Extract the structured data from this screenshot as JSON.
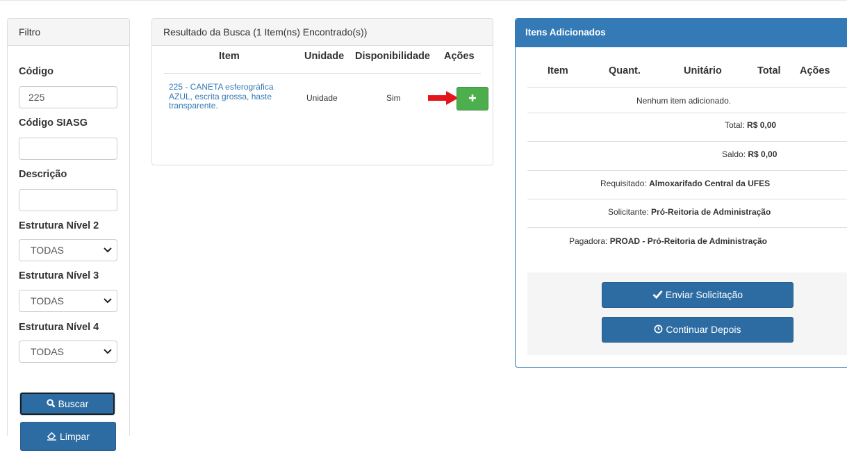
{
  "filter": {
    "title": "Filtro",
    "codigo_label": "Código",
    "codigo_value": "225",
    "siasg_label": "Código SIASG",
    "siasg_value": "",
    "descricao_label": "Descrição",
    "descricao_value": "",
    "nivel2_label": "Estrutura Nível 2",
    "nivel2_value": "TODAS",
    "nivel3_label": "Estrutura Nível 3",
    "nivel3_value": "TODAS",
    "nivel4_label": "Estrutura Nível 4",
    "nivel4_value": "TODAS",
    "buscar_label": "Buscar",
    "limpar_label": "Limpar"
  },
  "result": {
    "title": "Resultado da Busca (1 Item(ns) Encontrado(s))",
    "headers": {
      "item": "Item",
      "unidade": "Unidade",
      "disponibilidade": "Disponibilidade",
      "acoes": "Ações"
    },
    "rows": [
      {
        "item": "225 - CANETA esferográfica AZUL, escrita grossa, haste transparente.",
        "unidade": "Unidade",
        "disponibilidade": "Sim",
        "action_icon": "plus-icon"
      }
    ]
  },
  "added": {
    "title": "Itens Adicionados",
    "headers": {
      "item": "Item",
      "quant": "Quant.",
      "unitario": "Unitário",
      "total": "Total",
      "acoes": "Ações"
    },
    "empty_message": "Nenhum item adicionado.",
    "total_label": "Total:",
    "total_value": "R$ 0,00",
    "saldo_label": "Saldo:",
    "saldo_value": "R$ 0,00",
    "requisitado_label": "Requisitado:",
    "requisitado_value": "Almoxarifado Central da UFES",
    "solicitante_label": "Solicitante:",
    "solicitante_value": "Pró-Reitoria de Administração",
    "pagadora_label": "Pagadora:",
    "pagadora_value": "PROAD - Pró-Reitoria de Administração",
    "enviar_label": "Enviar Solicitação",
    "continuar_label": "Continuar Depois"
  },
  "colors": {
    "primary": "#2d6ca2",
    "panel_blue": "#337ab7",
    "success": "#4cae4c",
    "arrow": "#e3161b",
    "link": "#337ab7"
  }
}
